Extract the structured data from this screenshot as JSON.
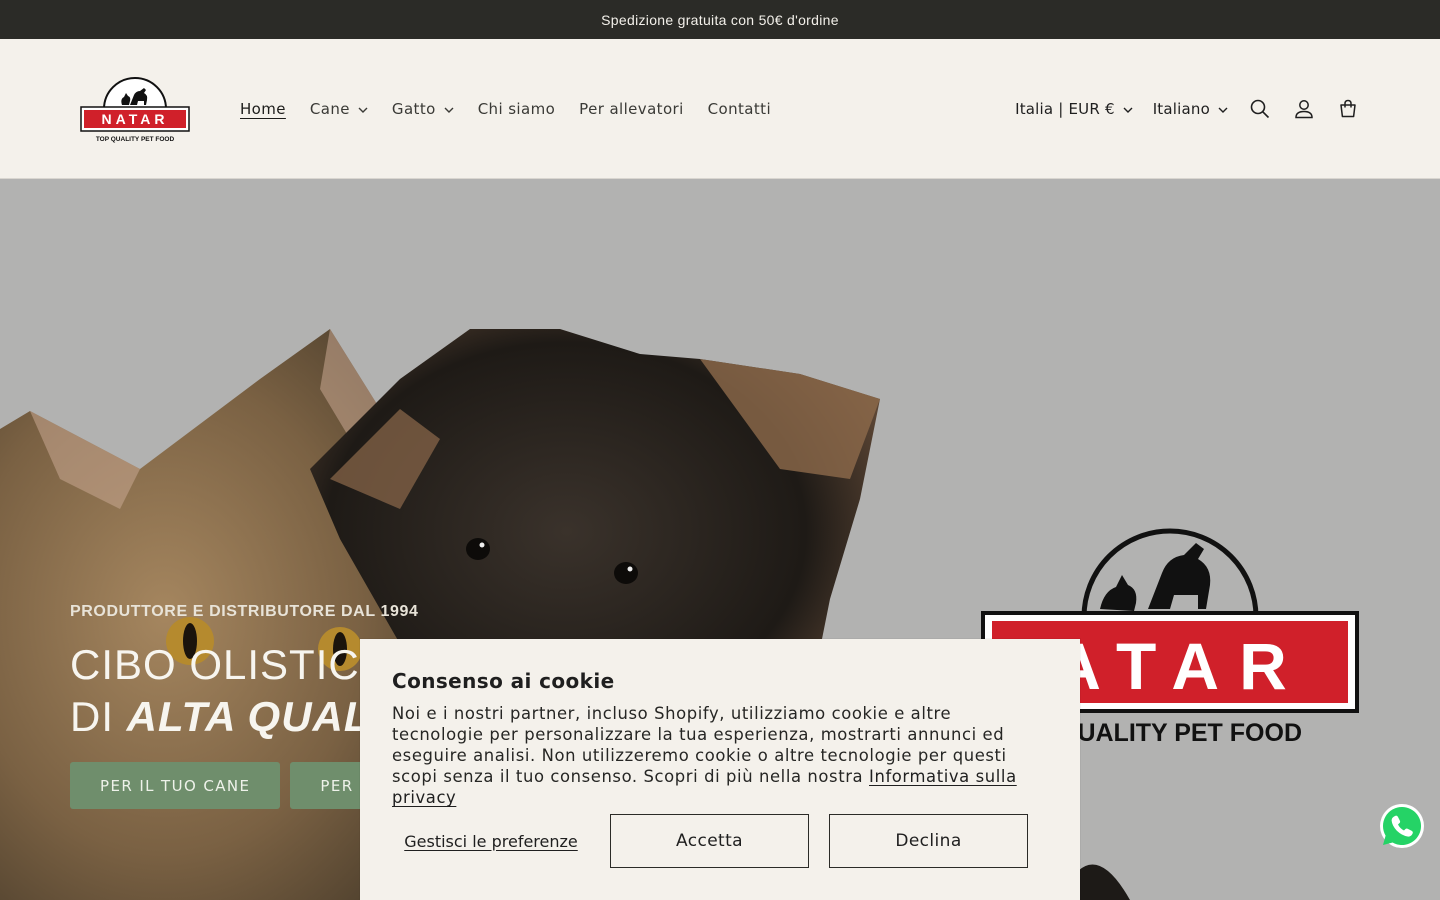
{
  "announcement": {
    "text": "Spedizione gratuita con 50€ d'ordine"
  },
  "logo": {
    "name": "NATAR",
    "tagline": "TOP QUALITY PET FOOD"
  },
  "nav": {
    "items": [
      {
        "label": "Home",
        "active": true,
        "dropdown": false
      },
      {
        "label": "Cane",
        "active": false,
        "dropdown": true
      },
      {
        "label": "Gatto",
        "active": false,
        "dropdown": true
      },
      {
        "label": "Chi siamo",
        "active": false,
        "dropdown": false
      },
      {
        "label": "Per allevatori",
        "active": false,
        "dropdown": false
      },
      {
        "label": "Contatti",
        "active": false,
        "dropdown": false
      }
    ]
  },
  "header": {
    "country_currency": "Italia | EUR €",
    "language": "Italiano",
    "icons": [
      "search-icon",
      "account-icon",
      "cart-icon"
    ]
  },
  "hero": {
    "eyebrow": "PRODUTTORE E DISTRIBUTORE DAL 1994",
    "title_line1": "CIBO OLISTICO",
    "title_line2_prefix": "DI ",
    "title_line2_emphasis": "ALTA QUALI",
    "buttons": [
      "PER IL TUO CANE",
      "PER IL"
    ],
    "brand_mark": {
      "name": "ATAR",
      "tagline": "QUALITY PET FOOD"
    }
  },
  "cookie_banner": {
    "title": "Consenso ai cookie",
    "body": "Noi e i nostri partner, incluso Shopify, utilizziamo cookie e altre tecnologie per personalizzare la tua esperienza, mostrarti annunci ed eseguire analisi. Non utilizzeremo cookie o altre tecnologie per questi scopi senza il tuo consenso. Scopri di più nella nostra ",
    "privacy_link": "Informativa sulla privacy",
    "manage_label": "Gestisci le preferenze",
    "accept_label": "Accetta",
    "decline_label": "Declina"
  },
  "colors": {
    "announcement_bg": "#2b2b27",
    "header_bg": "#f4f1eb",
    "hero_bg": "#b2b2b1",
    "button_green": "#6f8e6c",
    "brand_red": "#d0202a",
    "whatsapp_green": "#25d366"
  }
}
